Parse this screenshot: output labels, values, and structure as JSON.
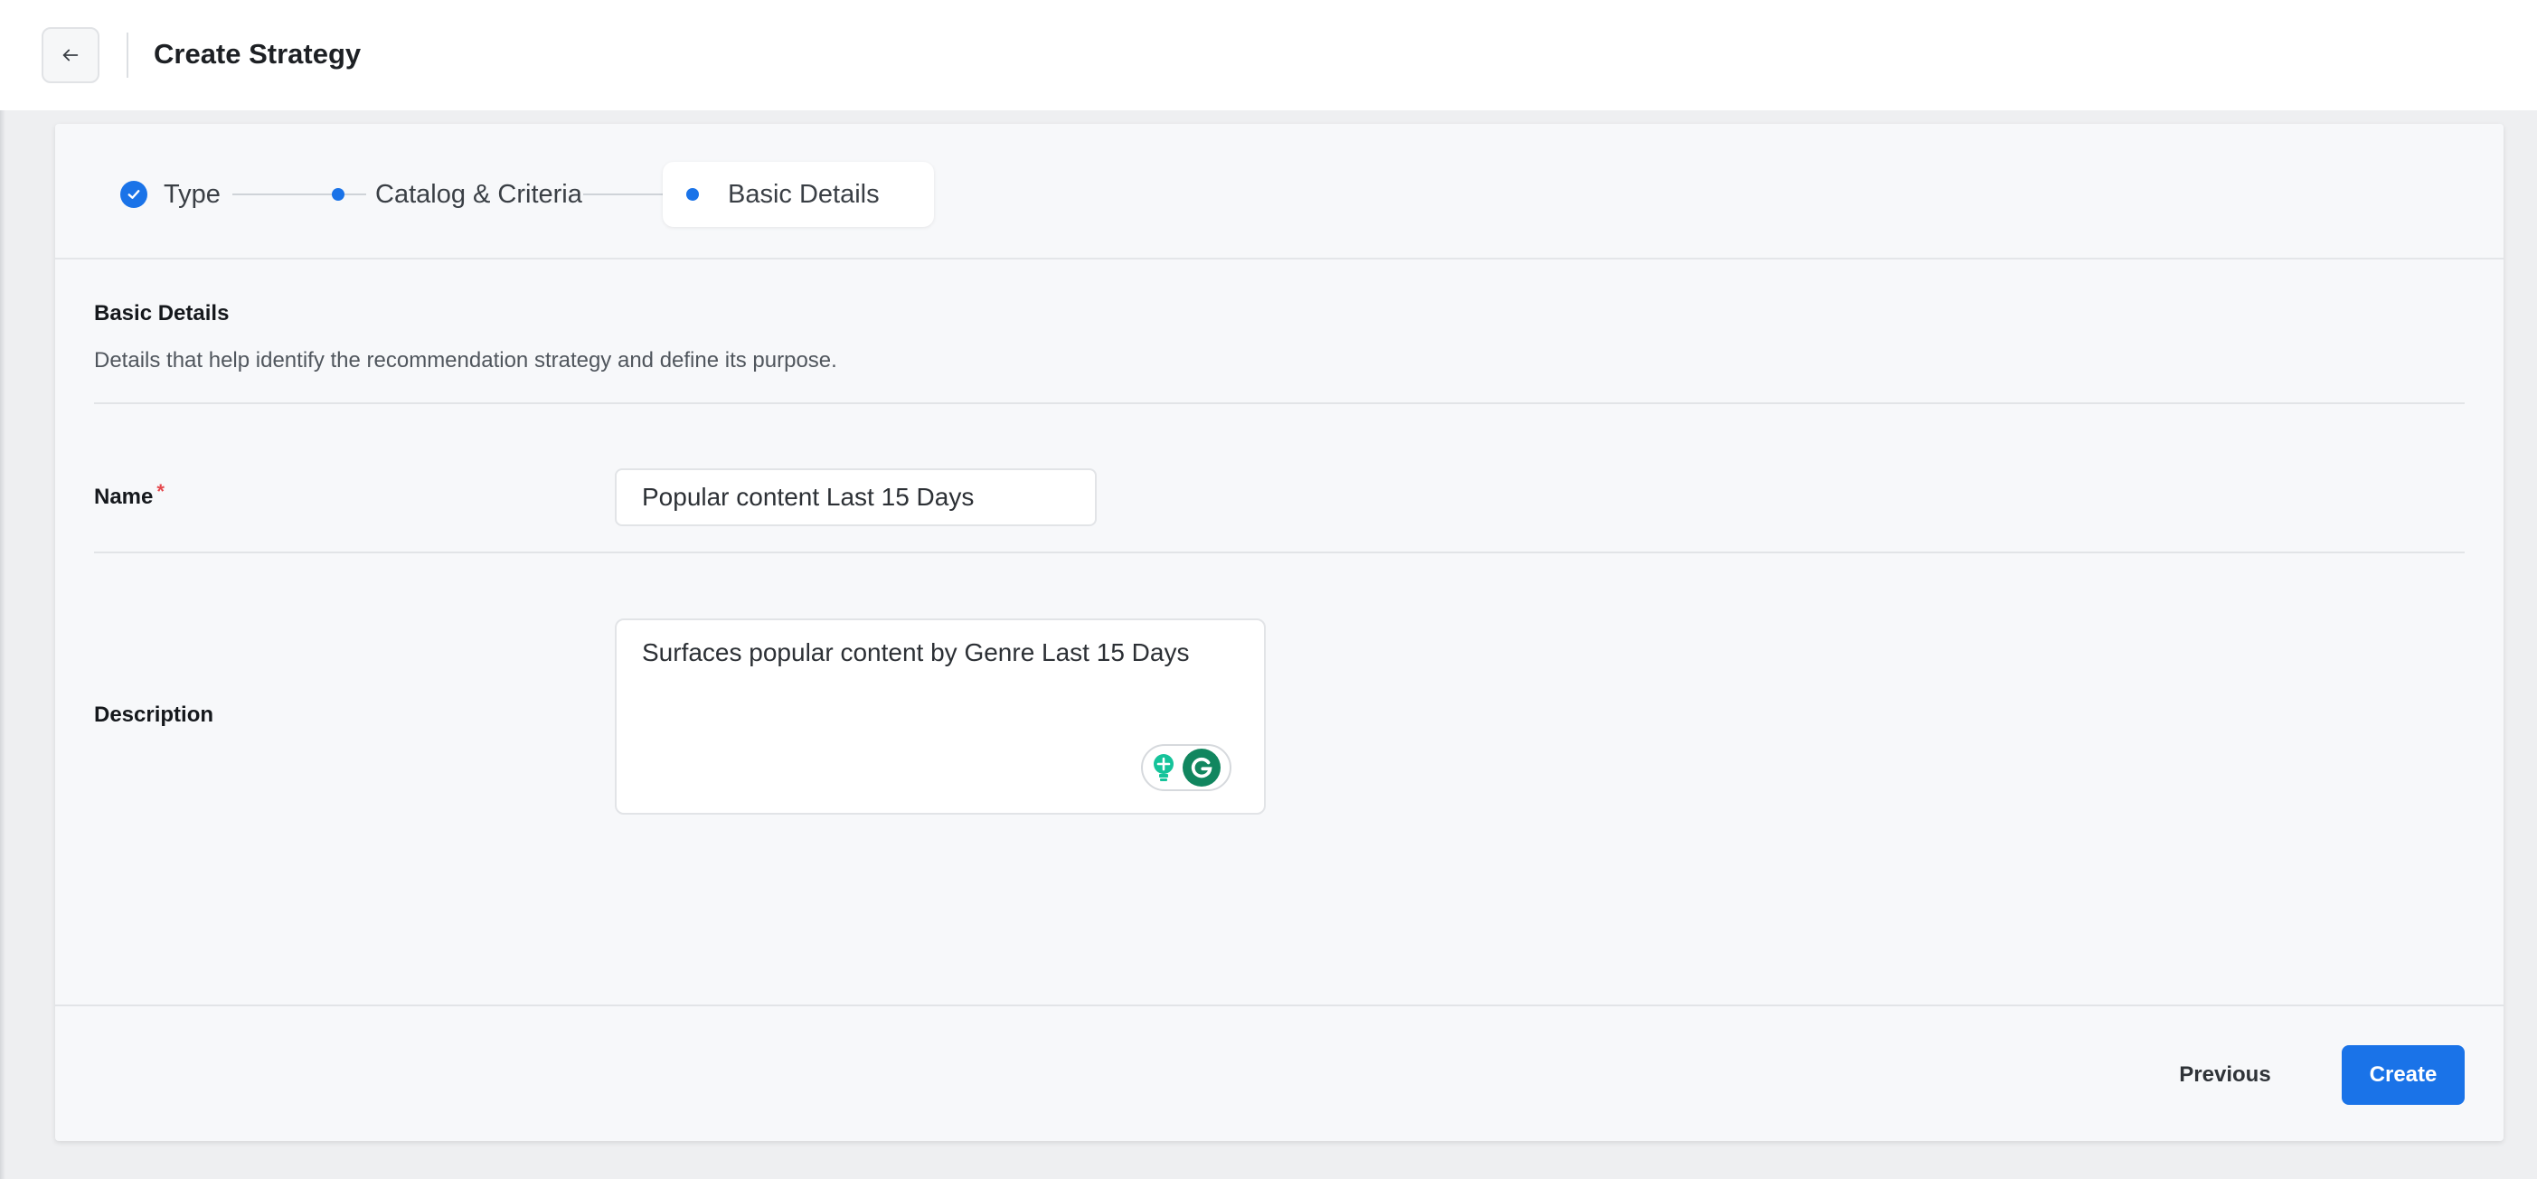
{
  "header": {
    "title": "Create Strategy",
    "back_icon": "arrow-left-icon"
  },
  "stepper": {
    "steps": [
      {
        "label": "Type",
        "state": "completed"
      },
      {
        "label": "Catalog & Criteria",
        "state": "completed"
      },
      {
        "label": "Basic Details",
        "state": "active"
      }
    ]
  },
  "section": {
    "title": "Basic Details",
    "description": "Details that help identify the recommendation strategy and define its purpose."
  },
  "form": {
    "name_label": "Name",
    "name_required_mark": "*",
    "name_value": "Popular content Last 15 Days",
    "description_label": "Description",
    "description_value": "Surfaces popular content by Genre Last 15 Days"
  },
  "footer": {
    "previous_label": "Previous",
    "create_label": "Create"
  },
  "colors": {
    "accent": "#1a73e8",
    "required": "#e5484d",
    "grammarly": "#11865f"
  }
}
